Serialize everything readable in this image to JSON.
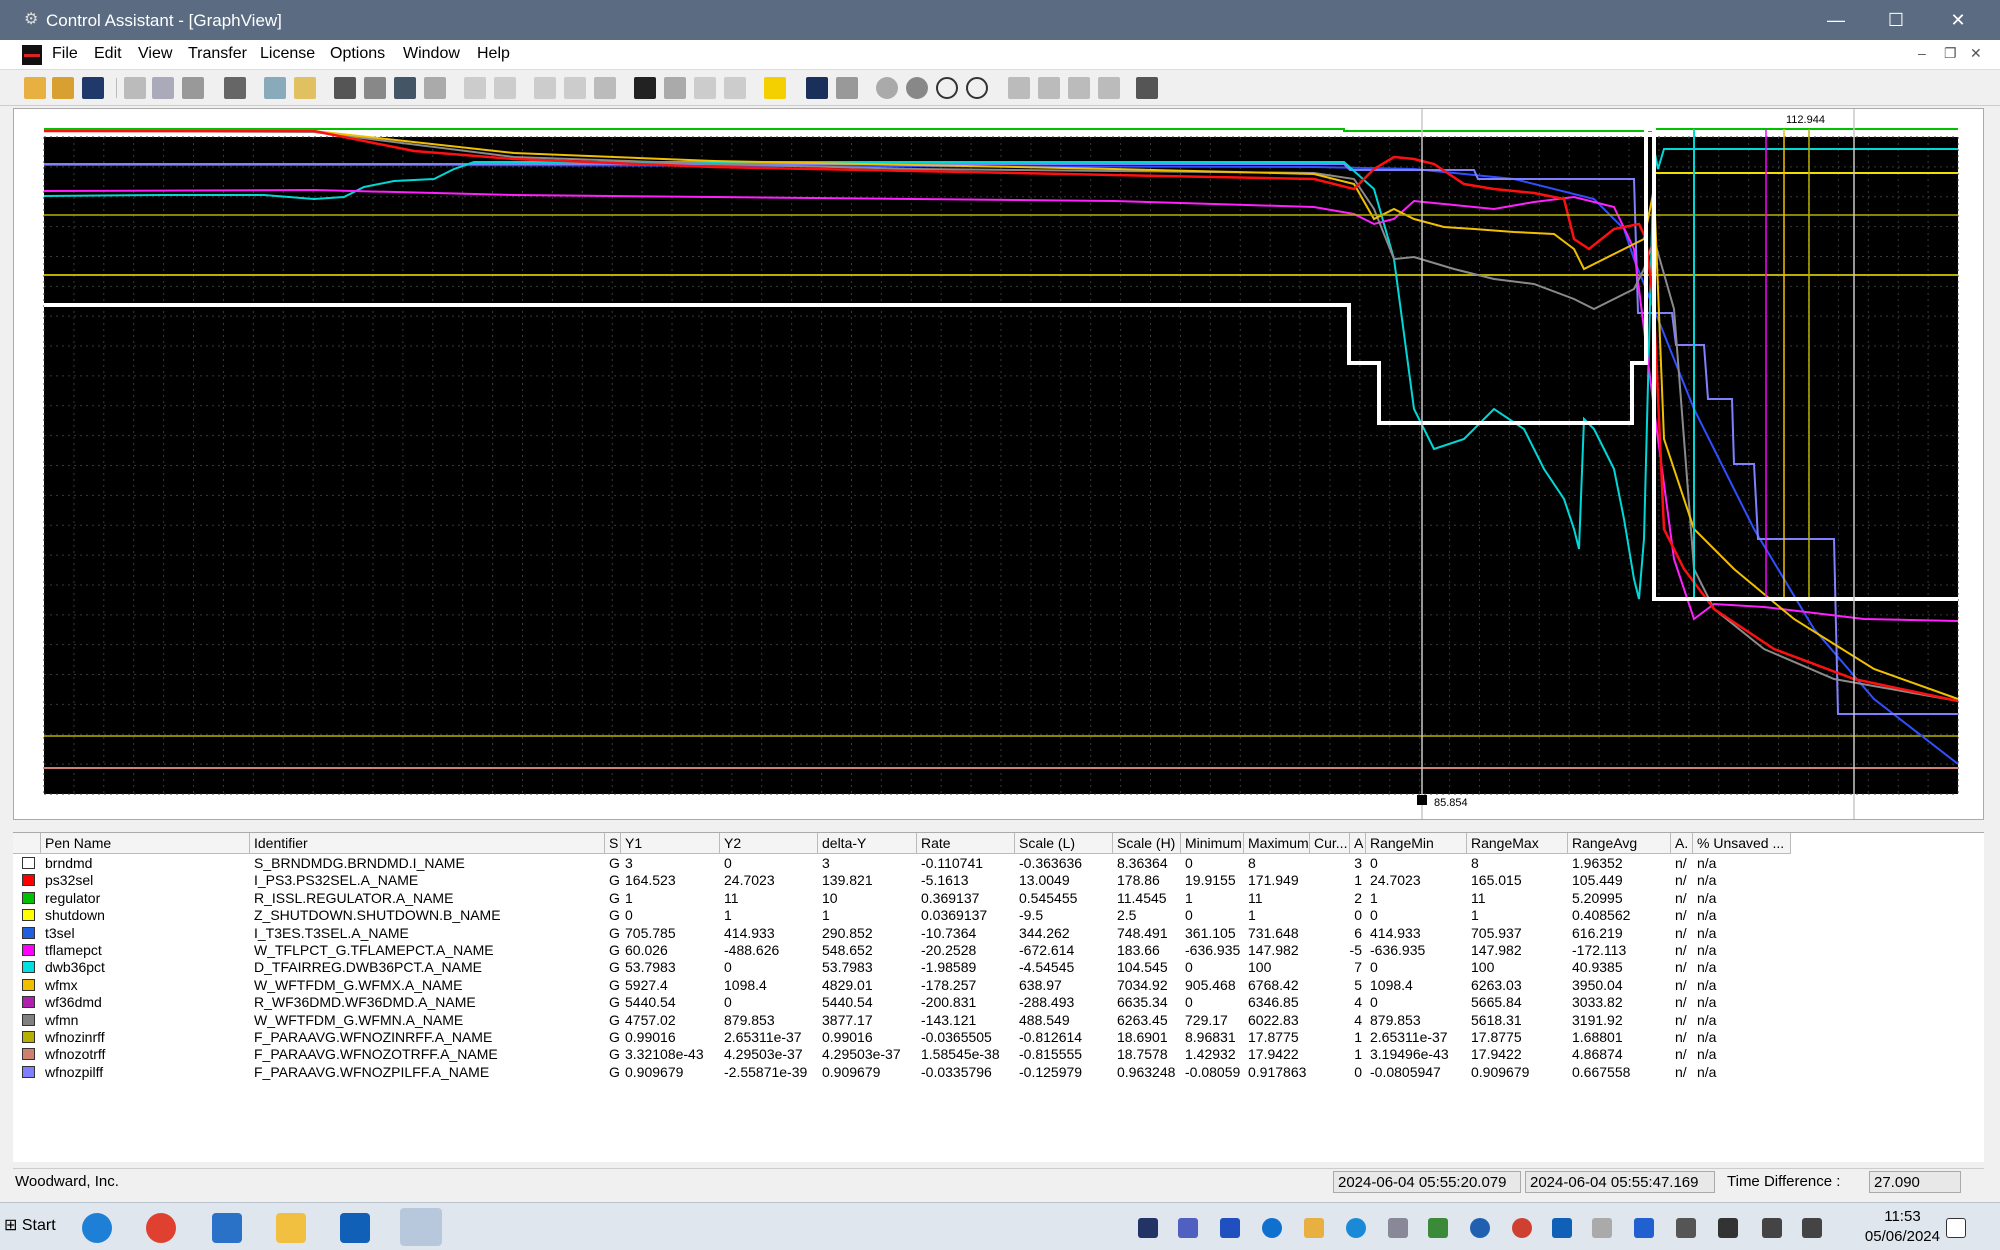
{
  "window": {
    "title": "Control Assistant - [GraphView]",
    "minimize": "—",
    "maximize": "☐",
    "close": "✕"
  },
  "menu": [
    "File",
    "Edit",
    "View",
    "Transfer",
    "License",
    "Options",
    "Window",
    "Help"
  ],
  "graph": {
    "top_cursor_label": "112.944",
    "bottom_cursor_label": "85.854"
  },
  "table": {
    "headers": [
      "Pen Name",
      "Identifier",
      "S",
      "Y1",
      "Y2",
      "delta-Y",
      "Rate",
      "Scale (L)",
      "Scale (H)",
      "Minimum",
      "Maximum",
      "Cur...",
      "A",
      "RangeMin",
      "RangeMax",
      "RangeAvg",
      "A.",
      "% Unsaved ..."
    ],
    "rows": [
      {
        "color": "#ffffff",
        "pen": "brndmd",
        "id": "S_BRNDMDG.BRNDMD.I_NAME",
        "s": "G",
        "y1": "3",
        "y2": "0",
        "dy": "3",
        "rate": "-0.110741",
        "sl": "-0.363636",
        "sh": "8.36364",
        "min": "0",
        "max": "8",
        "a": "3",
        "rmin": "0",
        "rmax": "8",
        "ravg": "1.96352",
        "a2": "n/",
        "uns": "n/a"
      },
      {
        "color": "#ff0000",
        "pen": "ps32sel",
        "id": "I_PS3.PS32SEL.A_NAME",
        "s": "G",
        "y1": "164.523",
        "y2": "24.7023",
        "dy": "139.821",
        "rate": "-5.1613",
        "sl": "13.0049",
        "sh": "178.86",
        "min": "19.9155",
        "max": "171.949",
        "a": "1",
        "rmin": "24.7023",
        "rmax": "165.015",
        "ravg": "105.449",
        "a2": "n/",
        "uns": "n/a"
      },
      {
        "color": "#00c000",
        "pen": "regulator",
        "id": "R_ISSL.REGULATOR.A_NAME",
        "s": "G",
        "y1": "1",
        "y2": "11",
        "dy": "10",
        "rate": "0.369137",
        "sl": "0.545455",
        "sh": "11.4545",
        "min": "1",
        "max": "11",
        "a": "2",
        "rmin": "1",
        "rmax": "11",
        "ravg": "5.20995",
        "a2": "n/",
        "uns": "n/a"
      },
      {
        "color": "#ffff00",
        "pen": "shutdown",
        "id": "Z_SHUTDOWN.SHUTDOWN.B_NAME",
        "s": "G",
        "y1": "0",
        "y2": "1",
        "dy": "1",
        "rate": "0.0369137",
        "sl": "-9.5",
        "sh": "2.5",
        "min": "0",
        "max": "1",
        "a": "0",
        "rmin": "0",
        "rmax": "1",
        "ravg": "0.408562",
        "a2": "n/",
        "uns": "n/a"
      },
      {
        "color": "#2060e0",
        "pen": "t3sel",
        "id": "I_T3ES.T3SEL.A_NAME",
        "s": "G",
        "y1": "705.785",
        "y2": "414.933",
        "dy": "290.852",
        "rate": "-10.7364",
        "sl": "344.262",
        "sh": "748.491",
        "min": "361.105",
        "max": "731.648",
        "a": "6",
        "rmin": "414.933",
        "rmax": "705.937",
        "ravg": "616.219",
        "a2": "n/",
        "uns": "n/a"
      },
      {
        "color": "#ff00ff",
        "pen": "tflamepct",
        "id": "W_TFLPCT_G.TFLAMEPCT.A_NAME",
        "s": "G",
        "y1": "60.026",
        "y2": "-488.626",
        "dy": "548.652",
        "rate": "-20.2528",
        "sl": "-672.614",
        "sh": "183.66",
        "min": "-636.935",
        "max": "147.982",
        "a": "-5",
        "rmin": "-636.935",
        "rmax": "147.982",
        "ravg": "-172.113",
        "a2": "n/",
        "uns": "n/a"
      },
      {
        "color": "#00e0e0",
        "pen": "dwb36pct",
        "id": "D_TFAIRREG.DWB36PCT.A_NAME",
        "s": "G",
        "y1": "53.7983",
        "y2": "0",
        "dy": "53.7983",
        "rate": "-1.98589",
        "sl": "-4.54545",
        "sh": "104.545",
        "min": "0",
        "max": "100",
        "a": "7",
        "rmin": "0",
        "rmax": "100",
        "ravg": "40.9385",
        "a2": "n/",
        "uns": "n/a"
      },
      {
        "color": "#f0c000",
        "pen": "wfmx",
        "id": "W_WFTFDM_G.WFMX.A_NAME",
        "s": "G",
        "y1": "5927.4",
        "y2": "1098.4",
        "dy": "4829.01",
        "rate": "-178.257",
        "sl": "638.97",
        "sh": "7034.92",
        "min": "905.468",
        "max": "6768.42",
        "a": "5",
        "rmin": "1098.4",
        "rmax": "6263.03",
        "ravg": "3950.04",
        "a2": "n/",
        "uns": "n/a"
      },
      {
        "color": "#b020b0",
        "pen": "wf36dmd",
        "id": "R_WF36DMD.WF36DMD.A_NAME",
        "s": "G",
        "y1": "5440.54",
        "y2": "0",
        "dy": "5440.54",
        "rate": "-200.831",
        "sl": "-288.493",
        "sh": "6635.34",
        "min": "0",
        "max": "6346.85",
        "a": "4",
        "rmin": "0",
        "rmax": "5665.84",
        "ravg": "3033.82",
        "a2": "n/",
        "uns": "n/a"
      },
      {
        "color": "#808080",
        "pen": "wfmn",
        "id": "W_WFTFDM_G.WFMN.A_NAME",
        "s": "G",
        "y1": "4757.02",
        "y2": "879.853",
        "dy": "3877.17",
        "rate": "-143.121",
        "sl": "488.549",
        "sh": "6263.45",
        "min": "729.17",
        "max": "6022.83",
        "a": "4",
        "rmin": "879.853",
        "rmax": "5618.31",
        "ravg": "3191.92",
        "a2": "n/",
        "uns": "n/a"
      },
      {
        "color": "#b8b000",
        "pen": "wfnozinrff",
        "id": "F_PARAAVG.WFNOZINRFF.A_NAME",
        "s": "G",
        "y1": "0.99016",
        "y2": "2.65311e-37",
        "dy": "0.99016",
        "rate": "-0.0365505",
        "sl": "-0.812614",
        "sh": "18.6901",
        "min": "8.96831",
        "max": "17.8775",
        "a": "1",
        "rmin": "2.65311e-37",
        "rmax": "17.8775",
        "ravg": "1.68801",
        "a2": "n/",
        "uns": "n/a"
      },
      {
        "color": "#d08070",
        "pen": "wfnozotrff",
        "id": "F_PARAAVG.WFNOZOTRFF.A_NAME",
        "s": "G",
        "y1": "3.32108e-43",
        "y2": "4.29503e-37",
        "dy": "4.29503e-37",
        "rate": "1.58545e-38",
        "sl": "-0.815555",
        "sh": "18.7578",
        "min": "1.42932",
        "max": "17.9422",
        "a": "1",
        "rmin": "3.19496e-43",
        "rmax": "17.9422",
        "ravg": "4.86874",
        "a2": "n/",
        "uns": "n/a"
      },
      {
        "color": "#8080ff",
        "pen": "wfnozpilff",
        "id": "F_PARAAVG.WFNOZPILFF.A_NAME",
        "s": "G",
        "y1": "0.909679",
        "y2": "-2.55871e-39",
        "dy": "0.909679",
        "rate": "-0.0335796",
        "sl": "-0.125979",
        "sh": "0.963248",
        "min": "-0.08059",
        "max": "0.917863",
        "a": "0",
        "rmin": "-0.0805947",
        "rmax": "0.909679",
        "ravg": "0.667558",
        "a2": "n/",
        "uns": "n/a"
      }
    ]
  },
  "status": {
    "company": "Woodward, Inc.",
    "time1": "2024-06-04 05:55:20.079",
    "time2": "2024-06-04 05:55:47.169",
    "diff_label": "Time Difference :",
    "diff_value": "27.090"
  },
  "taskbar": {
    "start": "Start",
    "time": "11:53",
    "date": "05/06/2024"
  }
}
